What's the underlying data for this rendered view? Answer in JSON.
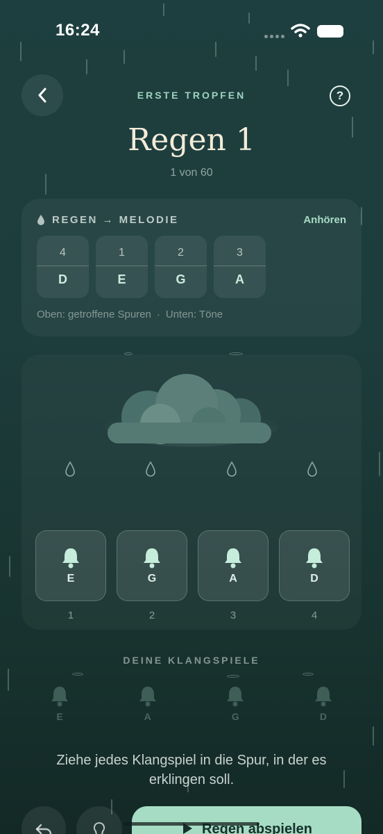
{
  "status_bar": {
    "time": "16:24"
  },
  "header": {
    "back_icon": "chevron-left-icon",
    "help_icon": "question-icon",
    "help_glyph": "?",
    "level_label": "ERSTE TROPFEN",
    "title": "Regen 1",
    "subtitle": "1 von 60"
  },
  "melody_card": {
    "title": "REGEN → MELODIE",
    "listen_label": "Anhören",
    "notes": [
      {
        "track": "4",
        "tone": "D"
      },
      {
        "track": "1",
        "tone": "E"
      },
      {
        "track": "2",
        "tone": "G"
      },
      {
        "track": "3",
        "tone": "A"
      }
    ],
    "caption_top": "Oben: getroffene Spuren",
    "caption_sep": "·",
    "caption_bottom": "Unten: Töne"
  },
  "play_area": {
    "chimes": [
      {
        "note": "E",
        "track": "1"
      },
      {
        "note": "G",
        "track": "2"
      },
      {
        "note": "A",
        "track": "3"
      },
      {
        "note": "D",
        "track": "4"
      }
    ]
  },
  "inventory": {
    "label": "DEINE KLANGSPIELE",
    "items": [
      "E",
      "A",
      "G",
      "D"
    ]
  },
  "instruction": "Ziehe jedes Klangspiel in die Spur, in der es erklingen soll.",
  "bottom_bar": {
    "play_label": "Regen abspielen",
    "undo_icon": "undo-icon",
    "hint_icon": "lightbulb-icon",
    "play_icon": "play-icon"
  },
  "colors": {
    "accent": "#a6dcc4",
    "background": "#1d3c3c",
    "title": "#f3ecd9"
  }
}
